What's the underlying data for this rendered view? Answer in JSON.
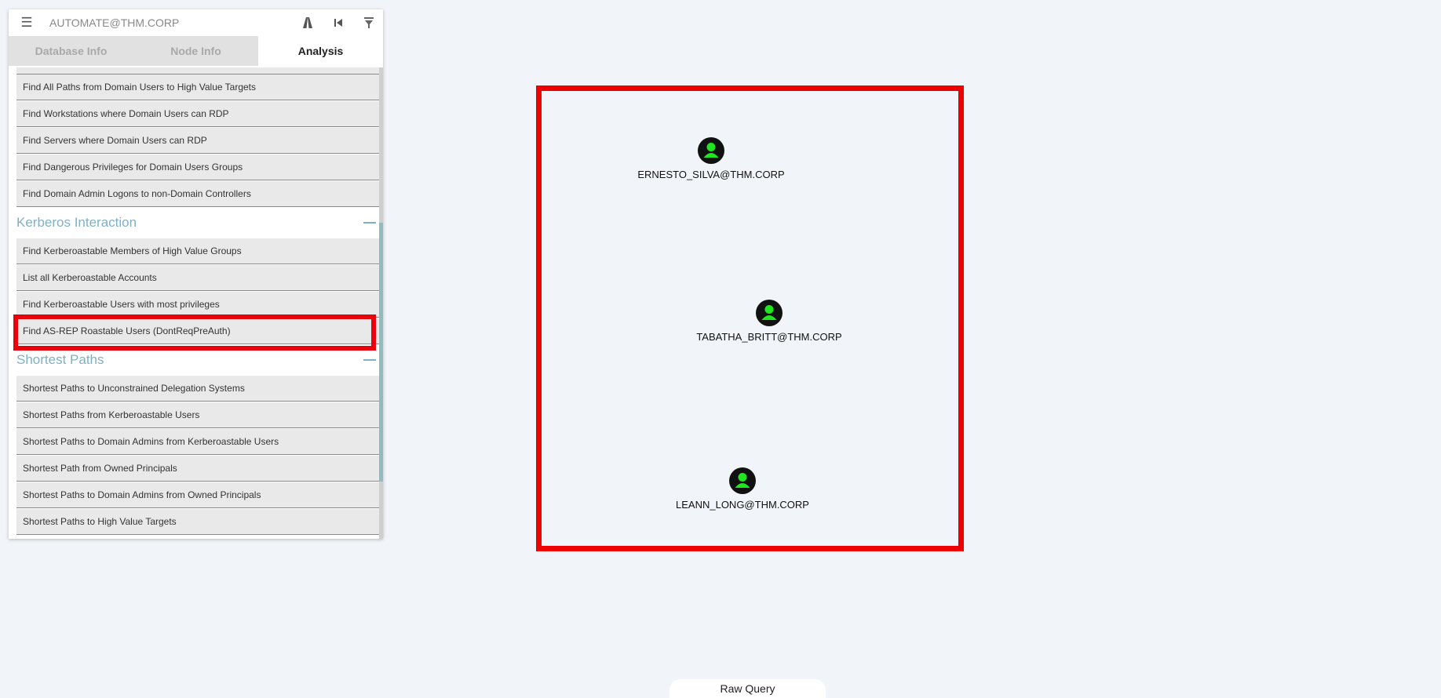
{
  "header": {
    "search_value": "AUTOMATE@THM.CORP",
    "menu_icon": "hamburger-menu-icon",
    "icons": [
      "path-finding-icon",
      "back-icon",
      "filter-icon"
    ]
  },
  "tabs": [
    {
      "label": "Database Info",
      "active": false
    },
    {
      "label": "Node Info",
      "active": false
    },
    {
      "label": "Analysis",
      "active": true
    }
  ],
  "queries_top": [
    "Find All Paths from Domain Users to High Value Targets",
    "Find Workstations where Domain Users can RDP",
    "Find Servers where Domain Users can RDP",
    "Find Dangerous Privileges for Domain Users Groups",
    "Find Domain Admin Logons to non-Domain Controllers"
  ],
  "sections": {
    "kerberos": {
      "title": "Kerberos Interaction",
      "items": [
        "Find Kerberoastable Members of High Value Groups",
        "List all Kerberoastable Accounts",
        "Find Kerberoastable Users with most privileges",
        "Find AS-REP Roastable Users (DontReqPreAuth)"
      ]
    },
    "shortest": {
      "title": "Shortest Paths",
      "items": [
        "Shortest Paths to Unconstrained Delegation Systems",
        "Shortest Paths from Kerberoastable Users",
        "Shortest Paths to Domain Admins from Kerberoastable Users",
        "Shortest Path from Owned Principals",
        "Shortest Paths to Domain Admins from Owned Principals",
        "Shortest Paths to High Value Targets"
      ]
    }
  },
  "graph": {
    "nodes": [
      {
        "label": "ERNESTO_SILVA@THM.CORP",
        "icon": "user-icon"
      },
      {
        "label": "TABATHA_BRITT@THM.CORP",
        "icon": "user-icon"
      },
      {
        "label": "LEANN_LONG@THM.CORP",
        "icon": "user-icon"
      }
    ]
  },
  "footer": {
    "raw_query_label": "Raw Query"
  },
  "colors": {
    "highlight": "#e8000b",
    "section_header": "#7eb1c3",
    "node_fill": "#111111",
    "node_user": "#1fe61f"
  }
}
